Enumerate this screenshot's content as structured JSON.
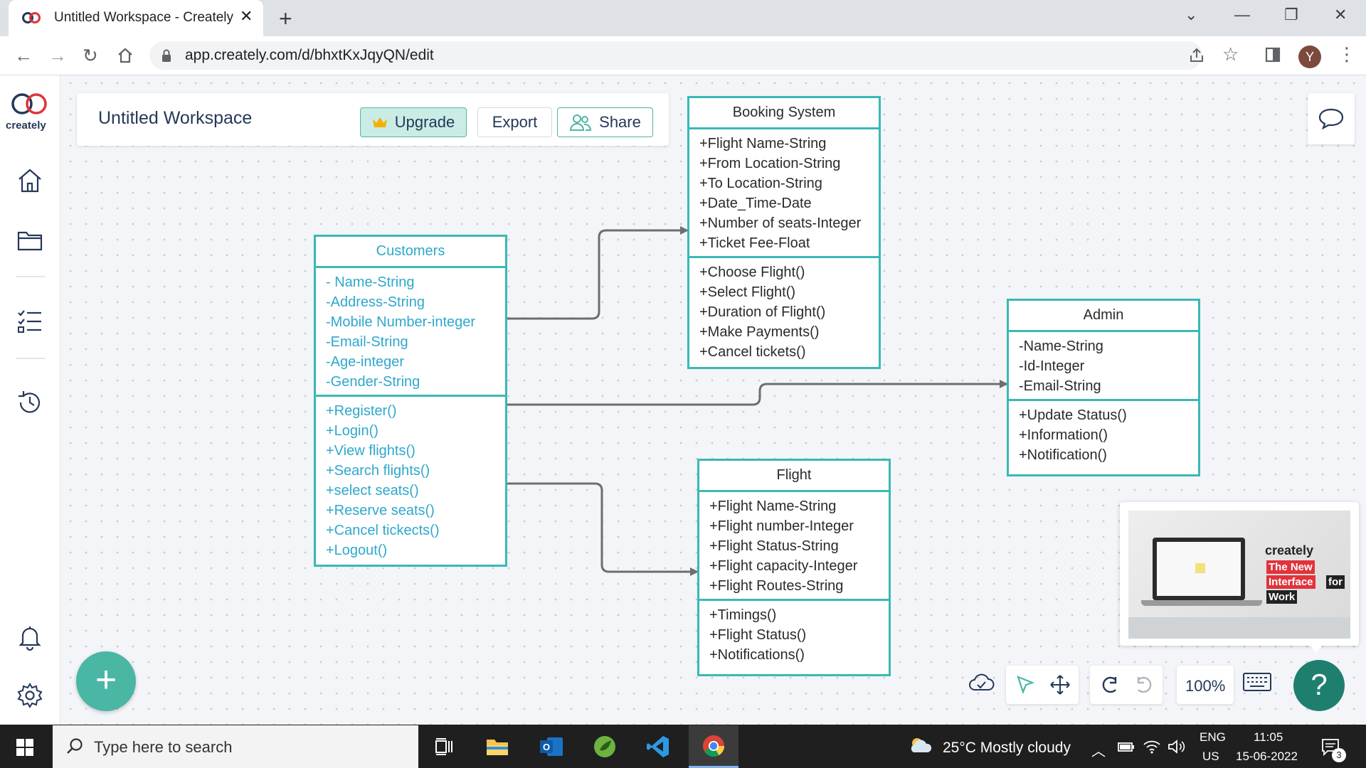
{
  "browser": {
    "tab_title": "Untitled Workspace - Creately",
    "url": "app.creately.com/d/bhxtKxJqyQN/edit",
    "profile_initial": "Y"
  },
  "app": {
    "logo_text": "creately",
    "workspace_title": "Untitled Workspace",
    "upgrade_label": "Upgrade",
    "export_label": "Export",
    "share_label": "Share",
    "zoom_level": "100%",
    "help_label": "?",
    "add_label": "+"
  },
  "promo": {
    "brand": "creately",
    "line1": "The New",
    "line2a": "Interface",
    "line2b": "for",
    "line3": "Work"
  },
  "diagram": {
    "customers": {
      "name": "Customers",
      "attributes": [
        "-  Name-String",
        "-Address-String",
        "-Mobile Number-integer",
        "-Email-String",
        "-Age-integer",
        "-Gender-String"
      ],
      "methods": [
        "+Register()",
        "+Login()",
        "+View flights()",
        "+Search flights()",
        "+select seats()",
        "+Reserve seats()",
        "+Cancel tickects()",
        "+Logout()"
      ]
    },
    "booking": {
      "name": "Booking System",
      "attributes": [
        "+Flight Name-String",
        "+From Location-String",
        "+To  Location-String",
        "+Date_Time-Date",
        "+Number of seats-Integer",
        "+Ticket Fee-Float"
      ],
      "methods": [
        "+Choose Flight()",
        "+Select Flight()",
        "+Duration of Flight()",
        "+Make Payments()",
        "+Cancel tickets()"
      ]
    },
    "admin": {
      "name": "Admin",
      "attributes": [
        "-Name-String",
        "-Id-Integer",
        "-Email-String"
      ],
      "methods": [
        "+Update Status()",
        "+Information()",
        "+Notification()"
      ]
    },
    "flight": {
      "name": "Flight",
      "attributes": [
        "+Flight Name-String",
        "+Flight number-Integer",
        "+Flight Status-String",
        "+Flight capacity-Integer",
        "+Flight Routes-String"
      ],
      "methods": [
        "+Timings()",
        "+Flight Status()",
        "+Notifications()"
      ]
    }
  },
  "taskbar": {
    "search_placeholder": "Type here to search",
    "weather": "25°C  Mostly cloudy",
    "lang_top": "ENG",
    "lang_bottom": "US",
    "time": "11:05",
    "date": "15-06-2022",
    "notif_count": "3"
  }
}
